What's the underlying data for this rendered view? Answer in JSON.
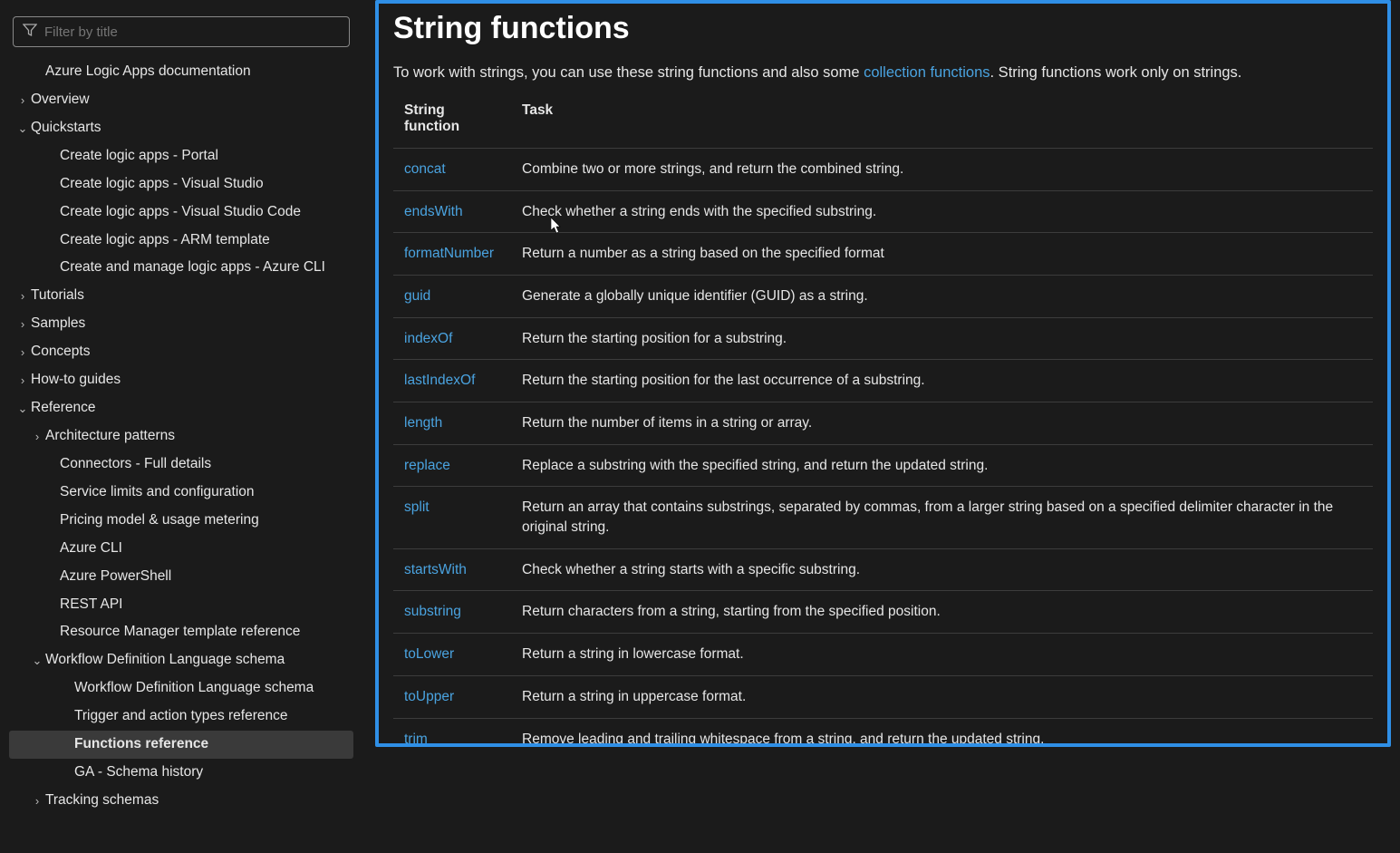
{
  "filter": {
    "placeholder": "Filter by title"
  },
  "nav": [
    {
      "label": "Azure Logic Apps documentation",
      "depth": 1,
      "chev": ""
    },
    {
      "label": "Overview",
      "depth": 0,
      "chev": ">"
    },
    {
      "label": "Quickstarts",
      "depth": 0,
      "chev": "v"
    },
    {
      "label": "Create logic apps - Portal",
      "depth": 2,
      "chev": ""
    },
    {
      "label": "Create logic apps - Visual Studio",
      "depth": 2,
      "chev": ""
    },
    {
      "label": "Create logic apps - Visual Studio Code",
      "depth": 2,
      "chev": ""
    },
    {
      "label": "Create logic apps - ARM template",
      "depth": 2,
      "chev": ""
    },
    {
      "label": "Create and manage logic apps - Azure CLI",
      "depth": 2,
      "chev": ""
    },
    {
      "label": "Tutorials",
      "depth": 0,
      "chev": ">"
    },
    {
      "label": "Samples",
      "depth": 0,
      "chev": ">"
    },
    {
      "label": "Concepts",
      "depth": 0,
      "chev": ">"
    },
    {
      "label": "How-to guides",
      "depth": 0,
      "chev": ">"
    },
    {
      "label": "Reference",
      "depth": 0,
      "chev": "v"
    },
    {
      "label": "Architecture patterns",
      "depth": 1,
      "chev": ">"
    },
    {
      "label": "Connectors - Full details",
      "depth": 2,
      "chev": ""
    },
    {
      "label": "Service limits and configuration",
      "depth": 2,
      "chev": ""
    },
    {
      "label": "Pricing model & usage metering",
      "depth": 2,
      "chev": ""
    },
    {
      "label": "Azure CLI",
      "depth": 2,
      "chev": ""
    },
    {
      "label": "Azure PowerShell",
      "depth": 2,
      "chev": ""
    },
    {
      "label": "REST API",
      "depth": 2,
      "chev": ""
    },
    {
      "label": "Resource Manager template reference",
      "depth": 2,
      "chev": ""
    },
    {
      "label": "Workflow Definition Language schema",
      "depth": 1,
      "chev": "v"
    },
    {
      "label": "Workflow Definition Language schema",
      "depth": 3,
      "chev": ""
    },
    {
      "label": "Trigger and action types reference",
      "depth": 3,
      "chev": ""
    },
    {
      "label": "Functions reference",
      "depth": 3,
      "chev": "",
      "active": true
    },
    {
      "label": "GA - Schema history",
      "depth": 3,
      "chev": ""
    },
    {
      "label": "Tracking schemas",
      "depth": 1,
      "chev": ">"
    }
  ],
  "page": {
    "title": "String functions",
    "intro_pre": "To work with strings, you can use these string functions and also some ",
    "intro_link": "collection functions",
    "intro_post": ". String functions work only on strings."
  },
  "table": {
    "head_col1_line1": "String",
    "head_col1_line2": "function",
    "head_col2": "Task",
    "rows": [
      {
        "fn": "concat",
        "task": "Combine two or more strings, and return the combined string."
      },
      {
        "fn": "endsWith",
        "task": "Check whether a string ends with the specified substring."
      },
      {
        "fn": "formatNumber",
        "task": "Return a number as a string based on the specified format"
      },
      {
        "fn": "guid",
        "task": "Generate a globally unique identifier (GUID) as a string."
      },
      {
        "fn": "indexOf",
        "task": "Return the starting position for a substring."
      },
      {
        "fn": "lastIndexOf",
        "task": "Return the starting position for the last occurrence of a substring."
      },
      {
        "fn": "length",
        "task": "Return the number of items in a string or array."
      },
      {
        "fn": "replace",
        "task": "Replace a substring with the specified string, and return the updated string."
      },
      {
        "fn": "split",
        "task": "Return an array that contains substrings, separated by commas, from a larger string based on a specified delimiter character in the original string."
      },
      {
        "fn": "startsWith",
        "task": "Check whether a string starts with a specific substring."
      },
      {
        "fn": "substring",
        "task": "Return characters from a string, starting from the specified position."
      },
      {
        "fn": "toLower",
        "task": "Return a string in lowercase format."
      },
      {
        "fn": "toUpper",
        "task": "Return a string in uppercase format."
      },
      {
        "fn": "trim",
        "task": "Remove leading and trailing whitespace from a string, and return the updated string."
      }
    ]
  }
}
